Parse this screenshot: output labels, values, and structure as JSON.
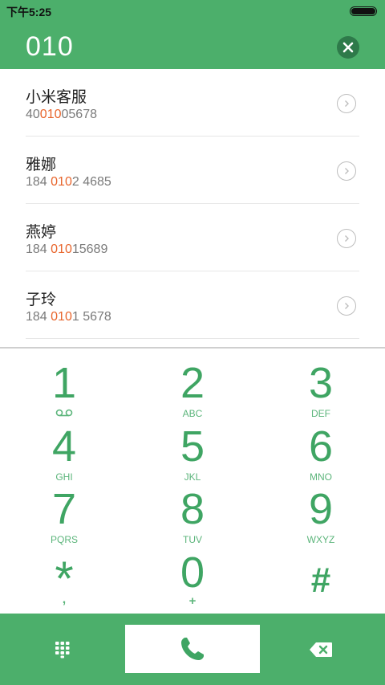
{
  "status_bar": {
    "time": "下午5:25",
    "battery_icon": "battery-full-icon"
  },
  "dialer": {
    "input_value": "010",
    "clear_icon": "clear-circle-icon"
  },
  "results": [
    {
      "name": "小米客服",
      "number_pre": "40",
      "number_match": "010",
      "number_post": "05678"
    },
    {
      "name": "雅娜",
      "number_pre": "184 ",
      "number_match": "010",
      "number_post": "2 4685"
    },
    {
      "name": "燕婷",
      "number_pre": "184 ",
      "number_match": "010",
      "number_post": "15689"
    },
    {
      "name": "子玲",
      "number_pre": "184 ",
      "number_match": "010",
      "number_post": "1 5678"
    }
  ],
  "keypad": {
    "keys": [
      {
        "digit": "1",
        "letters": ""
      },
      {
        "digit": "2",
        "letters": "ABC"
      },
      {
        "digit": "3",
        "letters": "DEF"
      },
      {
        "digit": "4",
        "letters": "GHI"
      },
      {
        "digit": "5",
        "letters": "JKL"
      },
      {
        "digit": "6",
        "letters": "MNO"
      },
      {
        "digit": "7",
        "letters": "PQRS"
      },
      {
        "digit": "8",
        "letters": "TUV"
      },
      {
        "digit": "9",
        "letters": "WXYZ"
      },
      {
        "digit": "*",
        "letters": ","
      },
      {
        "digit": "0",
        "letters": "+"
      },
      {
        "digit": "#",
        "letters": ""
      }
    ]
  },
  "bottom_bar": {
    "keypad_icon": "dialpad-grid-icon",
    "call_icon": "phone-call-icon",
    "delete_icon": "backspace-icon"
  },
  "colors": {
    "accent_green": "#4caf6b",
    "digit_green": "#3fa563",
    "match_highlight": "#e8652c"
  }
}
